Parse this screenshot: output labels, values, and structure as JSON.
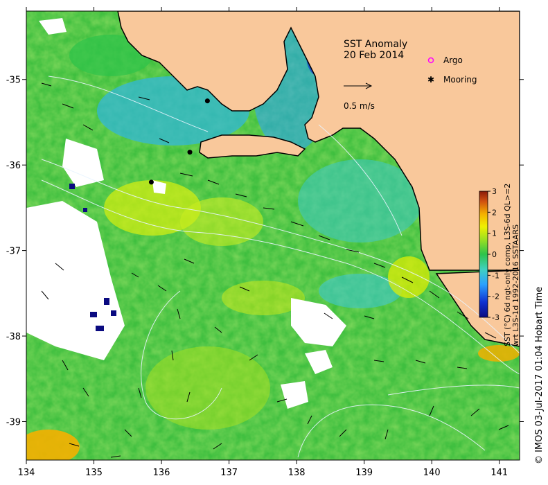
{
  "title": {
    "line1": "SST Anomaly",
    "line2": "20 Feb 2014"
  },
  "legend": {
    "argo_label": "Argo",
    "mooring_label": "Mooring",
    "vector_label": "0.5 m/s",
    "argo_color": "#ff00ff",
    "mooring_color": "#000000"
  },
  "axes": {
    "lon_ticks": [
      "134",
      "135",
      "136",
      "137",
      "138",
      "139",
      "140",
      "141"
    ],
    "lat_ticks": [
      "-35",
      "-36",
      "-37",
      "-38",
      "-39"
    ],
    "lon_values": [
      134,
      135,
      136,
      137,
      138,
      139,
      140,
      141
    ],
    "lat_values": [
      -35,
      -36,
      -37,
      -38,
      -39
    ],
    "lon_range": [
      134,
      141.3
    ],
    "lat_range": [
      -39.45,
      -34.2
    ]
  },
  "colorbar": {
    "ticks": [
      "3",
      "2",
      "1",
      "0",
      "-1",
      "-2",
      "-3"
    ],
    "tick_values": [
      3,
      2,
      1,
      0,
      -1,
      -2,
      -3
    ],
    "label_line1": "SST (°C) 6d ngt-only comp, L3S-6d QL>=2",
    "label_line2": "wrt L3S-1d 1992-2016 SSTAARS",
    "stops": [
      "#0a0a80",
      "#1030d0",
      "#2aa0ff",
      "#40d0c0",
      "#2ec34a",
      "#9ee020",
      "#f0f000",
      "#f5b000",
      "#d05010",
      "#8a1a08"
    ]
  },
  "credit": "© IMOS 03-Jul-2017 01:04 Hobart Time",
  "colors": {
    "land": "#f9c89b",
    "sea_base": "#3fbf3f"
  },
  "moorings": [
    {
      "lon": 136.68,
      "lat": -35.25
    },
    {
      "lon": 136.42,
      "lat": -35.85
    },
    {
      "lon": 135.85,
      "lat": -36.2
    }
  ]
}
